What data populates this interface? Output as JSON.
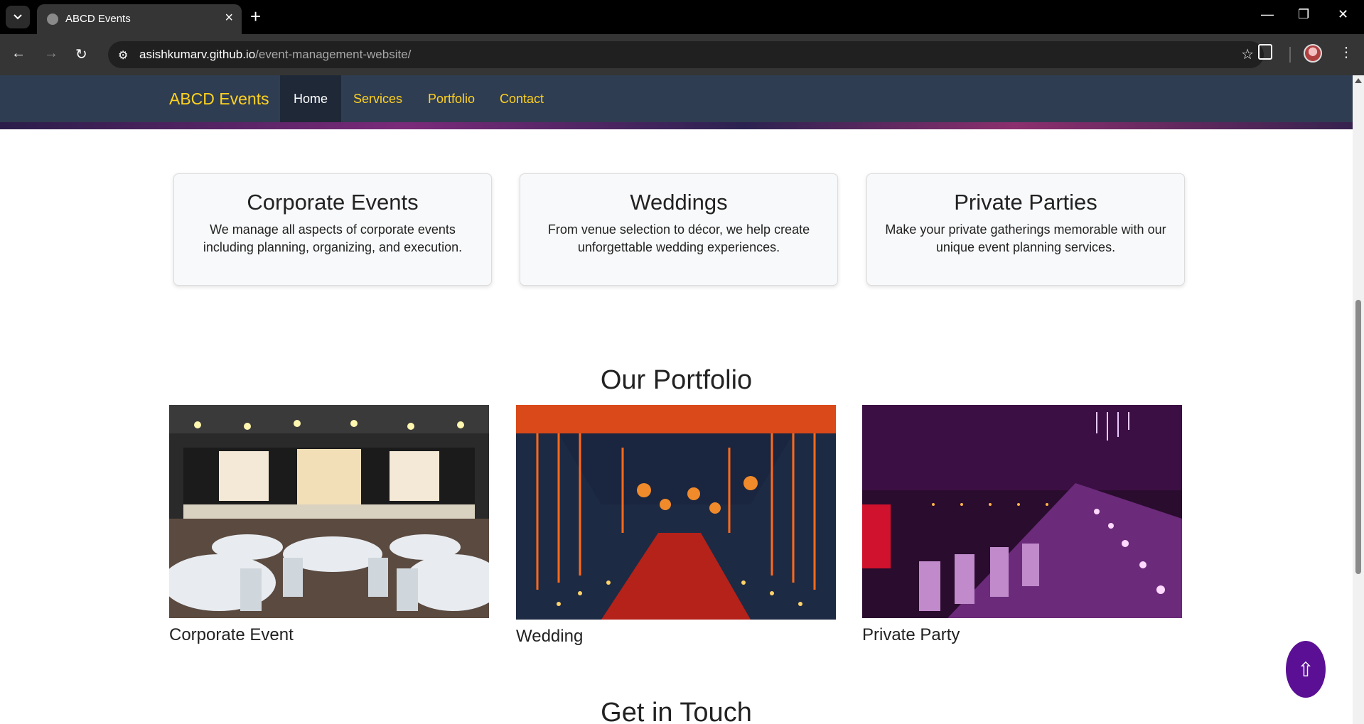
{
  "browser": {
    "tab_title": "ABCD Events",
    "url_host": "asishkumarv.github.io",
    "url_path": "/event-management-website/"
  },
  "site": {
    "brand": "ABCD Events",
    "nav": [
      {
        "label": "Home",
        "active": true
      },
      {
        "label": "Services",
        "active": false
      },
      {
        "label": "Portfolio",
        "active": false
      },
      {
        "label": "Contact",
        "active": false
      }
    ]
  },
  "services": [
    {
      "title": "Corporate Events",
      "text": "We manage all aspects of corporate events including planning, organizing, and execution."
    },
    {
      "title": "Weddings",
      "text": "From venue selection to décor, we help create unforgettable wedding experiences."
    },
    {
      "title": "Private Parties",
      "text": "Make your private gatherings memorable with our unique event planning services."
    }
  ],
  "portfolio": {
    "title": "Our Portfolio",
    "items": [
      {
        "caption": "Corporate Event",
        "image": "corporate-event-photo"
      },
      {
        "caption": "Wedding",
        "image": "wedding-photo"
      },
      {
        "caption": "Private Party",
        "image": "private-party-photo"
      }
    ]
  },
  "contact": {
    "title": "Get in Touch"
  },
  "scroll_top": {
    "icon": "up-arrow-icon",
    "glyph": "⇧",
    "color": "#5a0f94"
  },
  "colors": {
    "nav_bg": "#2f3d52",
    "brand": "#ffd21f"
  }
}
